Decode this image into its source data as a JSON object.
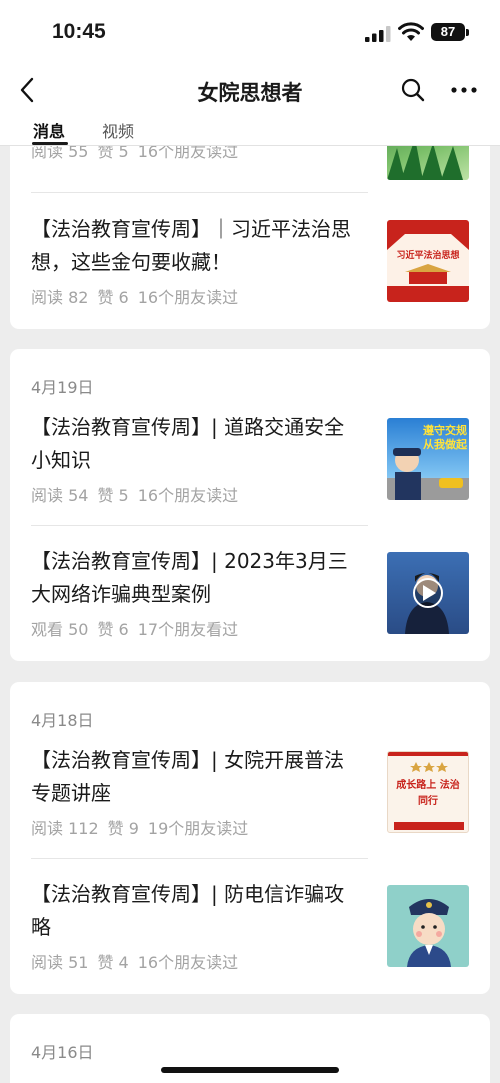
{
  "status_bar": {
    "time": "10:45",
    "battery": "87"
  },
  "nav": {
    "title": "女院思想者",
    "back_icon": "chevron-left-icon",
    "search_icon": "search-icon",
    "more_icon": "more-dots-icon"
  },
  "tabs": [
    {
      "label": "消息",
      "active": true
    },
    {
      "label": "视频",
      "active": false
    }
  ],
  "feed": {
    "partial_top": {
      "stats": [
        "阅读 55",
        "赞 5",
        "16个朋友读过"
      ]
    },
    "card0": {
      "articles": [
        {
          "title": "【法治教育宣传周】｜习近平法治思想，这些金句要收藏！",
          "stats": [
            "阅读 82",
            "赞 6",
            "16个朋友读过"
          ],
          "thumb_text": "习近平法治思想"
        }
      ]
    },
    "card1": {
      "date": "4月19日",
      "articles": [
        {
          "title": "【法治教育宣传周】| 道路交通安全小知识",
          "stats": [
            "阅读 54",
            "赞 5",
            "16个朋友读过"
          ],
          "thumb_text": "遵守交规 从我做起"
        },
        {
          "title": "【法治教育宣传周】| 2023年3月三大网络诈骗典型案例",
          "stats": [
            "观看 50",
            "赞 6",
            "17个朋友看过"
          ],
          "thumb_text": ""
        }
      ]
    },
    "card2": {
      "date": "4月18日",
      "articles": [
        {
          "title": "【法治教育宣传周】| 女院开展普法专题讲座",
          "stats": [
            "阅读 112",
            "赞 9",
            "19个朋友读过"
          ],
          "thumb_text": "成长路上 法治同行"
        },
        {
          "title": "【法治教育宣传周】| 防电信诈骗攻略",
          "stats": [
            "阅读 51",
            "赞 4",
            "16个朋友读过"
          ],
          "thumb_text": ""
        }
      ]
    },
    "card3": {
      "date": "4月16日"
    }
  },
  "colors": {
    "accent_red": "#c8231c",
    "text": "#1a1a1a",
    "muted": "#a3a3a3"
  }
}
